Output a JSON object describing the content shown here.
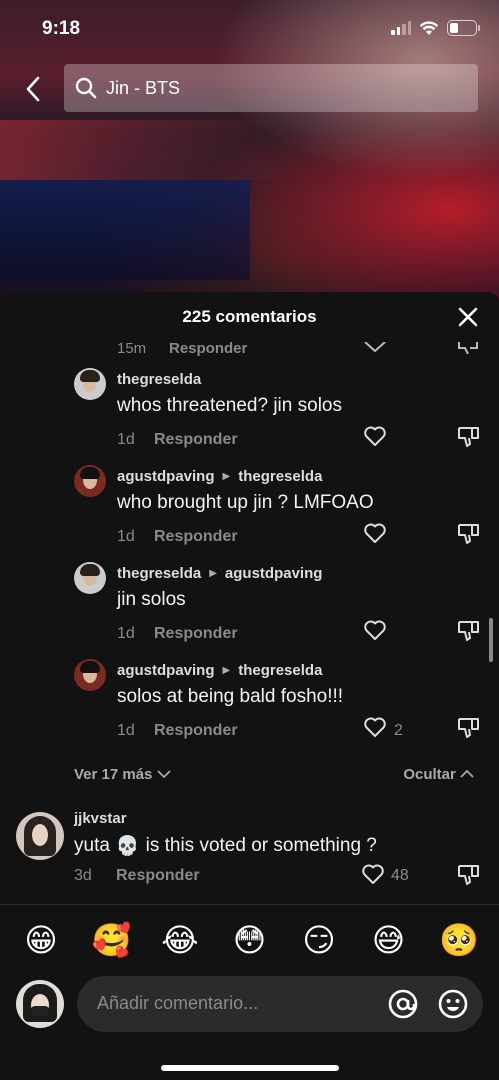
{
  "status_bar": {
    "time": "9:18"
  },
  "search": {
    "query": "Jin - BTS"
  },
  "comments_panel": {
    "title": "225 comentarios",
    "partial_row": {
      "time": "15m",
      "reply_label": "Responder"
    },
    "replies": [
      {
        "user": "thegreselda",
        "reply_to": "",
        "text": "whos threatened? jin solos",
        "time": "1d",
        "reply_label": "Responder",
        "likes": ""
      },
      {
        "user": "agustdpaving",
        "reply_to": "thegreselda",
        "text": "who brought up jin ? LMFOAO",
        "time": "1d",
        "reply_label": "Responder",
        "likes": ""
      },
      {
        "user": "thegreselda",
        "reply_to": "agustdpaving",
        "text": "jin solos",
        "time": "1d",
        "reply_label": "Responder",
        "likes": ""
      },
      {
        "user": "agustdpaving",
        "reply_to": "thegreselda",
        "text": "solos at being bald fosho!!!",
        "time": "1d",
        "reply_label": "Responder",
        "likes": "2"
      }
    ],
    "view_more": "Ver 17 más",
    "hide": "Ocultar",
    "top_comment": {
      "user": "jjkvstar",
      "text_before": "yuta",
      "emoji": "💀",
      "text_after": "is this voted or something ?",
      "time": "3d",
      "reply_label": "Responder",
      "likes": "48"
    }
  },
  "emoji_bar": [
    "😁",
    "🥰",
    "😂",
    "😳",
    "😏",
    "😅",
    "🥺"
  ],
  "input": {
    "placeholder": "Añadir comentario..."
  }
}
